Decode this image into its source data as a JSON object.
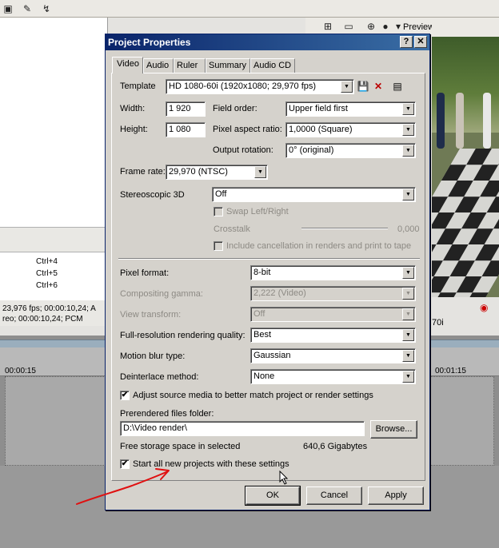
{
  "background": {
    "shortcuts": [
      "Ctrl+4",
      "Ctrl+5",
      "Ctrl+6"
    ],
    "media_info": [
      "23,976 fps; 00:00:10,24; A",
      "reo; 00:00:10,24; PCM"
    ],
    "timeline_times": [
      "00:00:15",
      "00:01:15"
    ],
    "preview_label": "Preview (Auto)",
    "preview_res": "70i"
  },
  "dialog": {
    "title": "Project Properties",
    "help_btn": "?",
    "close_btn": "✕",
    "tabs": [
      "Video",
      "Audio",
      "Ruler",
      "Summary",
      "Audio CD"
    ],
    "template_label": "Template",
    "template_value": "HD 1080-60i (1920x1080; 29,970 fps)",
    "width_label": "Width:",
    "width_value": "1 920",
    "height_label": "Height:",
    "height_value": "1 080",
    "field_order_label": "Field order:",
    "field_order_value": "Upper field first",
    "pixel_aspect_label": "Pixel aspect ratio:",
    "pixel_aspect_value": "1,0000 (Square)",
    "output_rotation_label": "Output rotation:",
    "output_rotation_value": "0° (original)",
    "frame_rate_label": "Frame rate:",
    "frame_rate_value": "29,970 (NTSC)",
    "stereo_label": "Stereoscopic 3D",
    "stereo_value": "Off",
    "swap_label": "Swap Left/Right",
    "crosstalk_label": "Crosstalk",
    "crosstalk_value": "0,000",
    "include_cancel_label": "Include cancellation in renders and print to tape",
    "pixel_format_label": "Pixel format:",
    "pixel_format_value": "8-bit",
    "compositing_label": "Compositing gamma:",
    "compositing_value": "2,222 (Video)",
    "view_transform_label": "View transform:",
    "view_transform_value": "Off",
    "full_res_label": "Full-resolution rendering quality:",
    "full_res_value": "Best",
    "motion_blur_label": "Motion blur type:",
    "motion_blur_value": "Gaussian",
    "deinterlace_label": "Deinterlace method:",
    "deinterlace_value": "None",
    "adjust_source_label": "Adjust source media to better match project or render settings",
    "adjust_source_checked": "✔",
    "prerendered_label": "Prerendered files folder:",
    "prerendered_value": "D:\\Video render\\",
    "browse_label": "Browse...",
    "free_storage_label": "Free storage space in selected",
    "free_storage_value": "640,6 Gigabytes",
    "start_all_label": "Start all new projects with these settings",
    "start_all_checked": "✔",
    "ok_label": "OK",
    "cancel_label": "Cancel",
    "apply_label": "Apply"
  },
  "annotation_color": "#e01010"
}
